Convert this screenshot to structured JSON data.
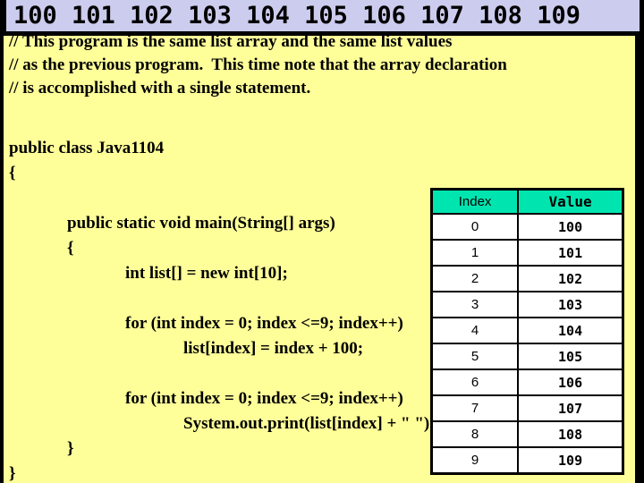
{
  "slide": {
    "background_color": "#FFFF99",
    "border_color": "#000000"
  },
  "output_banner": {
    "background_color": "#CCCCEE",
    "text": "100 101 102 103 104 105 106 107 108 109"
  },
  "comment_lines": [
    "// This program is the same list array and the same list values",
    "// as the previous program.  This time note that the array declaration",
    "// is accomplished with a single statement."
  ],
  "code_lines": [
    {
      "indent": 0,
      "text": "public class Java1104"
    },
    {
      "indent": 0,
      "text": "{"
    },
    {
      "indent": 0,
      "text": ""
    },
    {
      "indent": 1,
      "text": "public static void main(String[] args)"
    },
    {
      "indent": 1,
      "text": "{"
    },
    {
      "indent": 2,
      "text": "int list[] = new int[10];"
    },
    {
      "indent": 0,
      "text": ""
    },
    {
      "indent": 2,
      "text": "for (int index = 0; index <=9; index++)"
    },
    {
      "indent": 3,
      "text": "list[index] = index + 100;"
    },
    {
      "indent": 0,
      "text": ""
    },
    {
      "indent": 2,
      "text": "for (int index = 0; index <=9; index++)"
    },
    {
      "indent": 3,
      "text": "System.out.print(list[index] + \" \");"
    },
    {
      "indent": 1,
      "text": "}"
    },
    {
      "indent": 0,
      "text": "}"
    }
  ],
  "table": {
    "header_background": "#00E5B0",
    "columns": [
      "Index",
      "Value"
    ],
    "rows": [
      {
        "index": "0",
        "value": "100"
      },
      {
        "index": "1",
        "value": "101"
      },
      {
        "index": "2",
        "value": "102"
      },
      {
        "index": "3",
        "value": "103"
      },
      {
        "index": "4",
        "value": "104"
      },
      {
        "index": "5",
        "value": "105"
      },
      {
        "index": "6",
        "value": "106"
      },
      {
        "index": "7",
        "value": "107"
      },
      {
        "index": "8",
        "value": "108"
      },
      {
        "index": "9",
        "value": "109"
      }
    ]
  }
}
